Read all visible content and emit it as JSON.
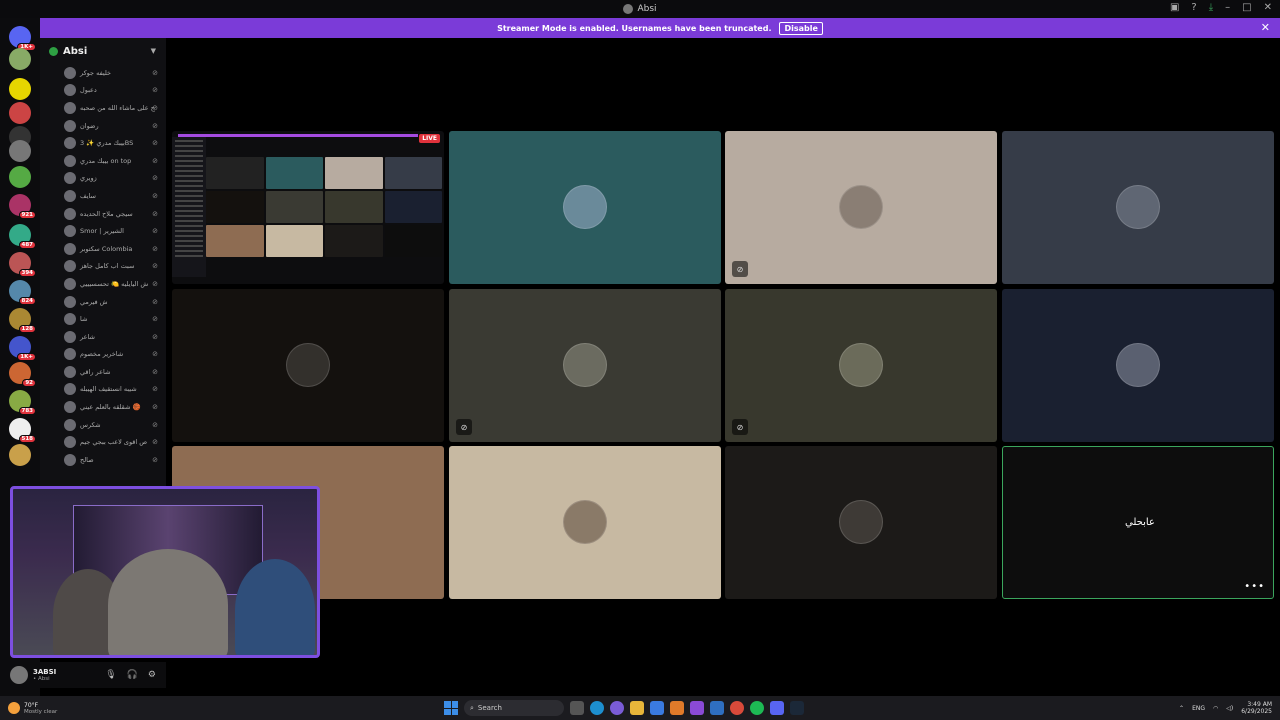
{
  "window": {
    "title": "Absi"
  },
  "banner": {
    "text": "Streamer Mode is enabled. Usernames have been truncated.",
    "disable_label": "Disable"
  },
  "servers": [
    {
      "badge": "1K+",
      "color": "#5865f2"
    },
    {
      "badge": "",
      "color": "#8a6"
    },
    {
      "badge": "",
      "color": "#e6d600"
    },
    {
      "badge": "",
      "color": "#c44"
    },
    {
      "badge": "",
      "color": "#333"
    },
    {
      "badge": "",
      "color": "#777"
    },
    {
      "badge": "",
      "color": "#5a4"
    },
    {
      "badge": "921",
      "color": "#a36"
    },
    {
      "badge": "487",
      "color": "#3a8"
    },
    {
      "badge": "394",
      "color": "#b55"
    },
    {
      "badge": "824",
      "color": "#58a"
    },
    {
      "badge": "128",
      "color": "#a83"
    },
    {
      "badge": "1K+",
      "color": "#45c"
    },
    {
      "badge": "92",
      "color": "#c63"
    },
    {
      "badge": "783",
      "color": "#8a4"
    },
    {
      "badge": "518",
      "color": "#eee"
    },
    {
      "badge": "",
      "color": "#c9a04a"
    }
  ],
  "sidebar": {
    "server_name": "Absi",
    "members": [
      {
        "name": "خليفه جوكر"
      },
      {
        "name": "دعبول"
      },
      {
        "name": "ح على ماشاء الله من صحبه"
      },
      {
        "name": "رضوان"
      },
      {
        "name": "بيبك مدري ✨ 3BS"
      },
      {
        "name": "بيبك مدري on top"
      },
      {
        "name": "زويري"
      },
      {
        "name": "سايف"
      },
      {
        "name": "سيجي ملاح الحديده"
      },
      {
        "name": "Smor | الشيرير"
      },
      {
        "name": "سكتوبر Colombia"
      },
      {
        "name": "سبت اب كامل جاهز"
      },
      {
        "name": "ش اليايليه 🍋 تحسسيييي"
      },
      {
        "name": "ش فيرمي"
      },
      {
        "name": "شا"
      },
      {
        "name": "شاعر"
      },
      {
        "name": "شاخرير مخصوم"
      },
      {
        "name": "شاعر راقي"
      },
      {
        "name": "شيبه انستقيف الهيبله"
      },
      {
        "name": "شقلقه بالعلم عيني 🏀"
      },
      {
        "name": "شكرس"
      },
      {
        "name": "ص اقوى لاعب ببجي جيم"
      },
      {
        "name": "صالح"
      }
    ]
  },
  "user_panel": {
    "name": "3ABSI",
    "status": "• Absi"
  },
  "tiles": [
    {
      "kind": "screen",
      "bg": "#0d0d0f",
      "live_label": "LIVE",
      "muted": false
    },
    {
      "bg": "#2b5b5e",
      "avatar": "#6a8a9a",
      "muted": false
    },
    {
      "bg": "#b7aba0",
      "avatar": "#8a7e74",
      "muted": true
    },
    {
      "bg": "#363c48",
      "avatar": "#5f6673",
      "muted": false
    },
    {
      "bg": "#14110e",
      "avatar": "#33302c",
      "muted": false
    },
    {
      "bg": "#3a3a33",
      "avatar": "#6b6b60",
      "muted": true
    },
    {
      "bg": "#38382d",
      "avatar": "#6b6b5a",
      "muted": true
    },
    {
      "bg": "#1a2030",
      "avatar": "#5a6070",
      "muted": false
    },
    {
      "bg": "#8e6c52",
      "avatar": "",
      "muted": false
    },
    {
      "bg": "#c7b9a2",
      "avatar": "#8a7a68",
      "muted": false
    },
    {
      "bg": "#1c1a18",
      "avatar": "#3e3a36",
      "muted": false
    },
    {
      "bg": "#0d0d0d",
      "avatar": "",
      "nick": "عابحلي",
      "muted": false,
      "active": true
    }
  ],
  "taskbar": {
    "weather_temp": "70°F",
    "weather_cond": "Mostly clear",
    "search_label": "Search",
    "lang": "ENG",
    "time": "3:49 AM",
    "date": "6/29/2025"
  }
}
